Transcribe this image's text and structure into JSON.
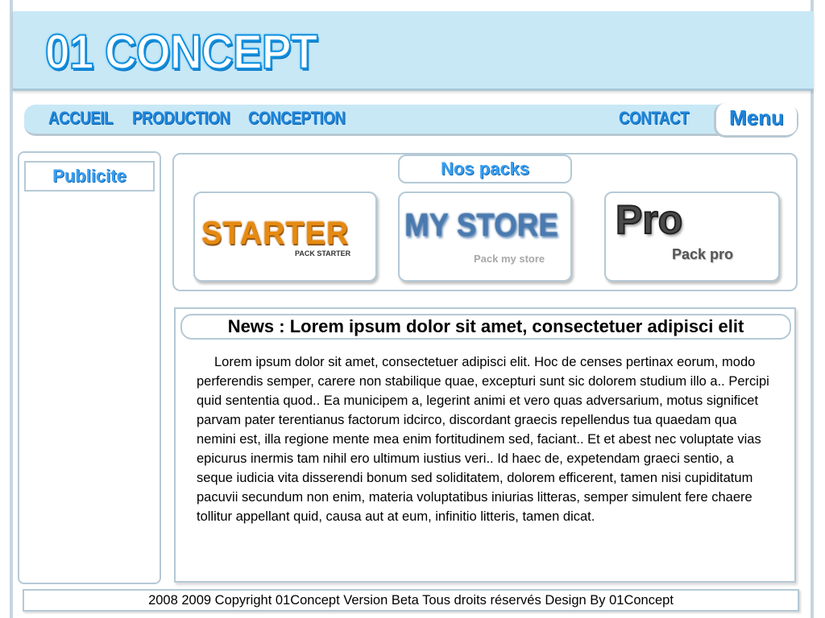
{
  "header": {
    "logo": "01 CONCEPT"
  },
  "nav": {
    "items": [
      {
        "label": "ACCUEIL"
      },
      {
        "label": "PRODUCTION"
      },
      {
        "label": "CONCEPTION"
      },
      {
        "label": "CONTACT"
      }
    ],
    "menu_label": "Menu"
  },
  "sidebar": {
    "title": "Publicite"
  },
  "packs": {
    "title": "Nos packs",
    "items": [
      {
        "big": "STARTER",
        "sub": "PACK  STARTER"
      },
      {
        "big": "MY STORE",
        "sub": "Pack my store"
      },
      {
        "big": "Pro",
        "sub": "Pack pro"
      }
    ]
  },
  "news": {
    "title": "News : Lorem ipsum dolor sit amet, consectetuer adipisci elit",
    "body": "Lorem ipsum dolor sit amet, consectetuer adipisci elit. Hoc de censes pertinax eorum, modo perferendis semper, carere non stabilique quae, excepturi sunt sic dolorem studium illo a.. Percipi quid sententia quod.. Ea municipem a, legerint animi et vero quas adversarium, motus significet parvam pater terentianus factorum idcirco, discordant graecis repellendus tua quaedam qua nemini est, illa regione mente mea enim fortitudinem sed, faciant.. Et et abest nec voluptate vias epicurus inermis tam nihil ero ultimum iustius veri.. Id haec de, expetendam graeci sentio, a seque iudicia vita disserendi bonum sed soliditatem, dolorem efficerent, tamen nisi cupiditatum pacuvii secundum non enim, materia voluptatibus iniurias litteras, semper simulent fere chaere tollitur appellant quid, causa aut at eum, infinitio litteris, tamen dicat."
  },
  "footer": {
    "text": "2008  2009 Copyright 01Concept Version Beta  Tous droits réservés Design By 01Concept"
  }
}
